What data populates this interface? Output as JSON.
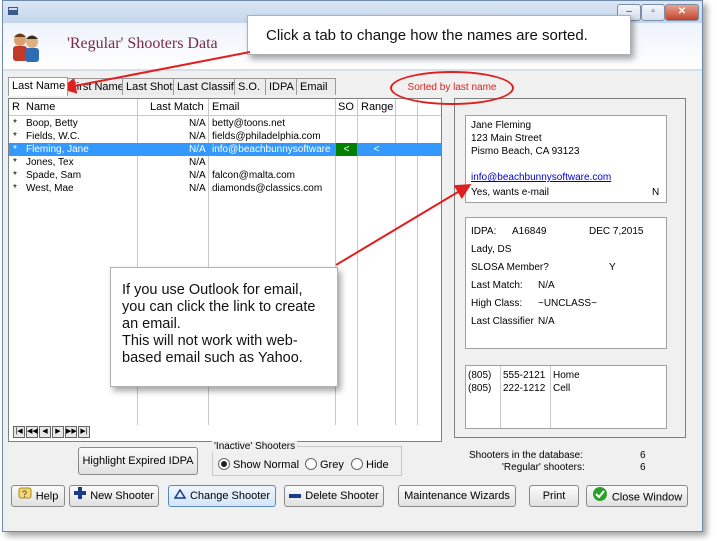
{
  "header": {
    "app_title": "'Regular' Shooters Data"
  },
  "tabs": [
    {
      "label": "Last Name",
      "active": true
    },
    {
      "label": "First Name",
      "active": false
    },
    {
      "label": "Last Shot",
      "active": false
    },
    {
      "label": "Last Classif",
      "active": false
    },
    {
      "label": "S.O.",
      "active": false
    },
    {
      "label": "IDPA",
      "active": false
    },
    {
      "label": "Email",
      "active": false
    }
  ],
  "grid": {
    "headers": {
      "r": "R",
      "name": "Name",
      "last_match": "Last Match",
      "email": "Email",
      "so": "SO",
      "range": "Range"
    },
    "rows": [
      {
        "r": "*",
        "name": "Boop, Betty",
        "last_match": "N/A",
        "email": "betty@toons.net",
        "so": "",
        "range": "",
        "selected": false
      },
      {
        "r": "*",
        "name": "Fields, W.C.",
        "last_match": "N/A",
        "email": "fields@philadelphia.com",
        "so": "",
        "range": "",
        "selected": false
      },
      {
        "r": "*",
        "name": "Fleming, Jane",
        "last_match": "N/A",
        "email": "info@beachbunnysoftware",
        "so": "<",
        "range": "<",
        "selected": true
      },
      {
        "r": "*",
        "name": "Jones, Tex",
        "last_match": "N/A",
        "email": "",
        "so": "",
        "range": "",
        "selected": false
      },
      {
        "r": "*",
        "name": "Spade, Sam",
        "last_match": "N/A",
        "email": "falcon@malta.com",
        "so": "",
        "range": "",
        "selected": false
      },
      {
        "r": "*",
        "name": "West, Mae",
        "last_match": "N/A",
        "email": "diamonds@classics.com",
        "so": "",
        "range": "",
        "selected": false
      }
    ]
  },
  "detail": {
    "name": "Jane  Fleming",
    "address1": "123 Main Street",
    "address2": "Pismo Beach, CA  93123",
    "email_link": "info@beachbunnysoftware.com",
    "wants_email": "Yes, wants e-mail",
    "wants_email_flag": "N",
    "idpa_label": "IDPA:",
    "idpa_number": "A16849",
    "idpa_date": "DEC  7,2015",
    "gender_division": "Lady,  DS",
    "slosa_label": "SLOSA Member?",
    "slosa_value": "Y",
    "last_match_label": "Last Match:",
    "last_match_value": "N/A",
    "high_class_label": "High Class:",
    "high_class_value": "~UNCLASS~",
    "last_classifier_label": "Last Classifier",
    "last_classifier_value": "N/A",
    "phones": [
      {
        "area": "(805)",
        "number": "555-2121",
        "type": "Home"
      },
      {
        "area": "(805)",
        "number": "222-1212",
        "type": "Cell"
      }
    ]
  },
  "controls": {
    "highlight_button": "Highlight  Expired IDPA",
    "inactive_group_title": "'Inactive' Shooters",
    "radio_show_normal": "Show Normal",
    "radio_grey": "Grey",
    "radio_hide": "Hide"
  },
  "stats": {
    "in_db_label": "Shooters in the database:",
    "in_db_value": "6",
    "regular_label": "'Regular' shooters:",
    "regular_value": "6"
  },
  "buttons": {
    "help": "Help",
    "new_shooter": "New Shooter",
    "change_shooter": "Change Shooter",
    "delete_shooter": "Delete Shooter",
    "maintenance": "Maintenance Wizards",
    "print": "Print",
    "close_window": "Close Window"
  },
  "annotations": {
    "top_callout": "Click a tab to change how the names are sorted.",
    "sorted_label": "Sorted by last name",
    "outlook_callout_1": "If you use Outlook for email, you can click the link to create an email.",
    "outlook_callout_2": "This will not work with web-based email such as Yahoo."
  },
  "colors": {
    "selection": "#3399ff",
    "so_green": "#008000",
    "annotation_red": "#e02020",
    "link_blue": "#0000cc"
  }
}
